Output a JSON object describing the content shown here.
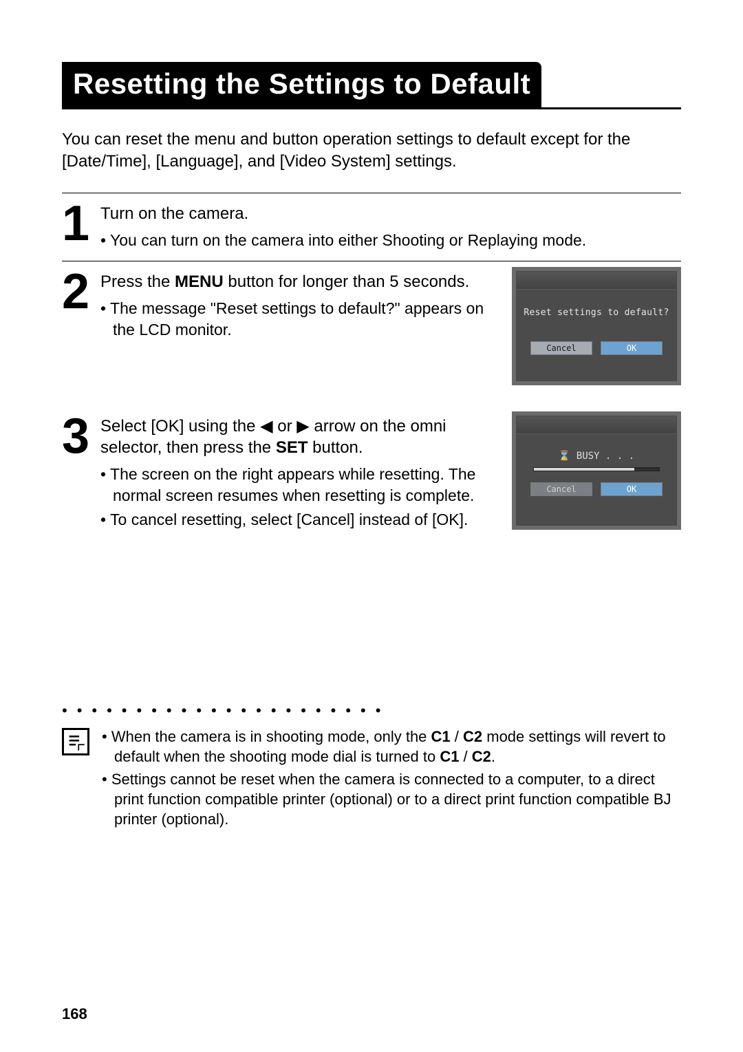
{
  "title": "Resetting the Settings to Default",
  "intro": "You can reset the menu and button operation settings to default except for the [Date/Time], [Language], and [Video System] settings.",
  "steps": {
    "s1": {
      "num": "1",
      "heading": "Turn on the camera.",
      "bullet1": "You can turn on the camera into either Shooting or Replaying mode."
    },
    "s2": {
      "num": "2",
      "heading_pre": "Press the ",
      "heading_bold": "MENU",
      "heading_post": " button for longer than 5 seconds.",
      "bullet1": "The message \"Reset settings to default?\" appears on the LCD monitor.",
      "lcd": {
        "message": "Reset settings to default?",
        "btn_cancel": "Cancel",
        "btn_ok": "OK"
      }
    },
    "s3": {
      "num": "3",
      "heading_pre": "Select [OK] using the ",
      "arrow_left": "◀",
      "heading_or": " or ",
      "arrow_right": "▶",
      "heading_mid": " arrow on the omni selector, then press the ",
      "heading_bold": "SET",
      "heading_post": " button.",
      "bullet1": "The screen on the right appears while resetting. The normal screen resumes when resetting is complete.",
      "bullet2": "To cancel resetting, select [Cancel] instead of [OK].",
      "lcd": {
        "busy_icon": "⌛",
        "busy_text": " BUSY . . .",
        "btn_cancel": "Cancel",
        "btn_ok": "OK"
      }
    }
  },
  "notes": {
    "n1_pre": "When the camera is in shooting mode, only the ",
    "n1_c1": "C1",
    "n1_slash1": " / ",
    "n1_c2": "C2",
    "n1_mid": " mode settings will revert to default when the shooting mode dial is turned to ",
    "n1_c1b": "C1",
    "n1_slash2": " / ",
    "n1_c2b": "C2",
    "n1_end": ".",
    "n2": "Settings cannot be reset when the camera is connected to a computer, to a direct print function compatible printer (optional) or to a direct print function compatible BJ printer (optional)."
  },
  "page_number": "168"
}
